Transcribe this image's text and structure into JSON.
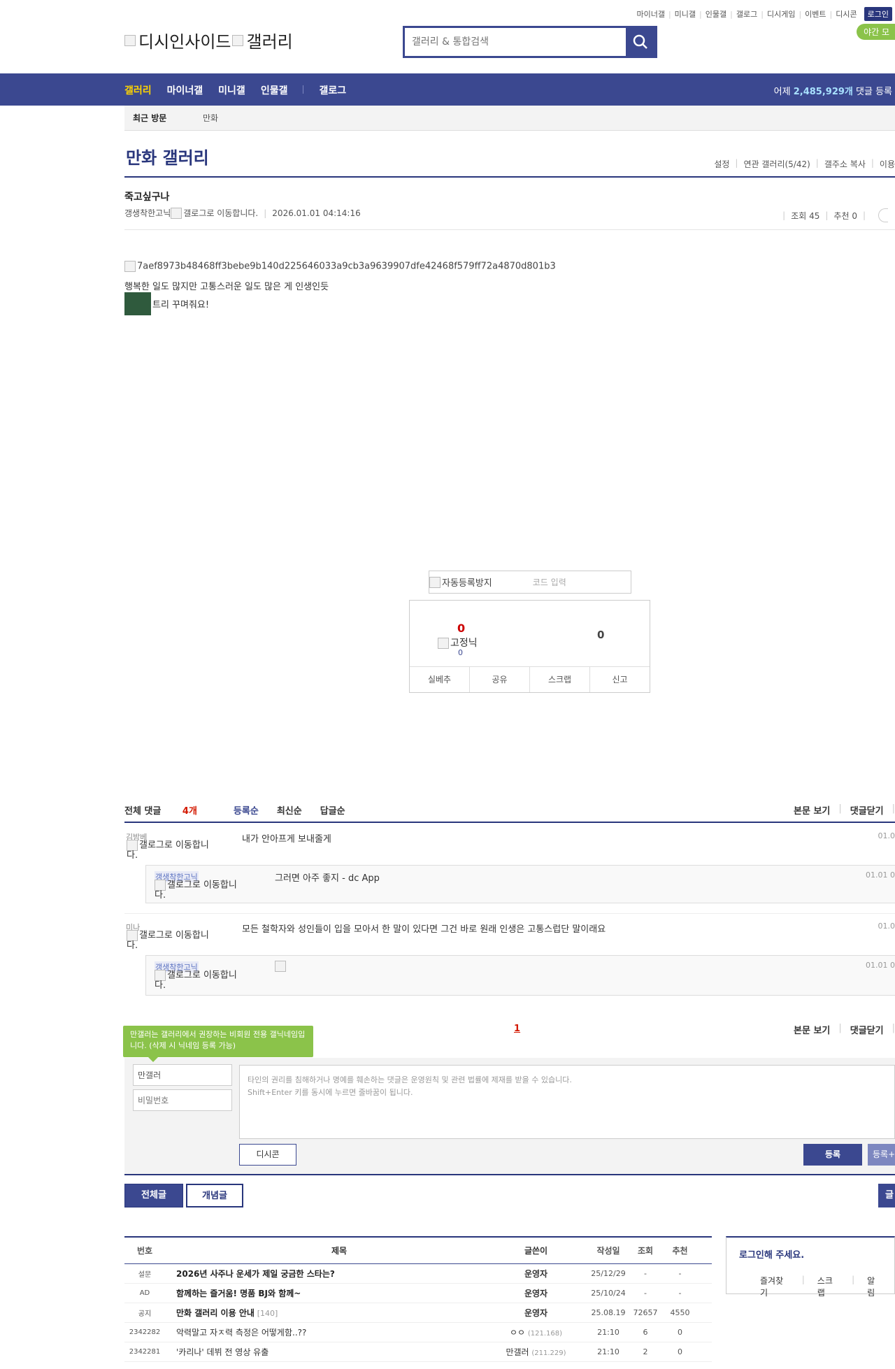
{
  "util_nav": [
    "마이너갤",
    "미니갤",
    "인물갤",
    "갤로그",
    "디시게임",
    "이벤트",
    "디시콘"
  ],
  "login_label": "로그인",
  "night_mode": "야간 모",
  "logo": {
    "site": "디시인사이드",
    "section": "갤러리"
  },
  "search": {
    "placeholder": "갤러리 & 통합검색"
  },
  "gnb": {
    "items": [
      "갤러리",
      "마이너갤",
      "미니갤",
      "인물갤"
    ],
    "gallog": "갤로그",
    "stat_prefix": "어제",
    "stat_value": "2,485,929개",
    "stat_suffix": "댓글 등록"
  },
  "recent": {
    "label": "최근 방문",
    "item": "만화"
  },
  "gallery": {
    "title": "만화 갤러리",
    "links": [
      "설정",
      "연관 갤러리(5/42)",
      "갤주소 복사",
      "이용"
    ]
  },
  "post": {
    "title": "죽고싶구나",
    "writer": "갱생착한고닉",
    "gallog_alt": "갤로그로 이동합니다.",
    "date": "2026.01.01 04:14:16",
    "views": "조회 45",
    "recommend": "추천 0",
    "image_alt": "7aef8973b48468ff3bebe9b140d225646033a9cb3a9639907dfe42468f579ff72a4870d801b3",
    "line1": "행복한 일도 많지만 고통스러운 일도 많은 게 인생인듯",
    "line2": "트리 꾸며줘요!"
  },
  "captcha": {
    "alt": "자동등록방지",
    "placeholder": "코드 입력"
  },
  "vote": {
    "up_count": "0",
    "fix_label": "고정닉",
    "fix_count": "0",
    "down_count": "0",
    "buttons": [
      "실베추",
      "공유",
      "스크랩",
      "신고"
    ]
  },
  "comments_header": {
    "total_label": "전체 댓글",
    "total_count": "4개",
    "sorts": [
      "등록순",
      "최신순",
      "답글순"
    ],
    "right": [
      "본문 보기",
      "댓글닫기"
    ]
  },
  "comments": [
    {
      "nick": "김밤베",
      "gallog": "갤로그로 이동합니다.",
      "text": "내가 안아프게 보내줄게",
      "date": "01.0",
      "reply": {
        "nick": "갱생착한고닉",
        "gallog": "갤로그로 이동합니다.",
        "text": "그러면 아주 좋지 - dc App",
        "date": "01.01 0"
      }
    },
    {
      "nick": "미나",
      "gallog": "갤로그로 이동합니다.",
      "text": "모든 철학자와 성인들이 입을 모아서 한 말이 있다면 그건 바로 원래 인생은 고통스럽단 말이래요",
      "date": "01.0",
      "reply": {
        "nick": "갱생착한고닉",
        "gallog": "갤로그로 이동합니다.",
        "text": "",
        "date": "01.01 0"
      }
    }
  ],
  "pagination": {
    "current": "1"
  },
  "write": {
    "tooltip": "만갤러는 갤러리에서 권장하는 비회원 전용 갤닉네임입니다. (삭제 시 닉네임 등록 가능)",
    "nick_value": "만갤러",
    "pw_placeholder": "비밀번호",
    "notice": "타인의 권리를 침해하거나 명예를 훼손하는 댓글은 운영원칙 및 관련 법률에 제재를 받을 수 있습니다.",
    "notice2": "Shift+Enter 키를 동시에 누르면 줄바꿈이 됩니다.",
    "dccon": "디시콘",
    "submit": "등록",
    "submit2": "등록+"
  },
  "tabs": {
    "all": "전체글",
    "recommend": "개념글",
    "write": "글"
  },
  "list": {
    "headers": [
      "번호",
      "제목",
      "글쓴이",
      "작성일",
      "조회",
      "추천"
    ],
    "rows": [
      {
        "no": "설문",
        "title": "2026년 사주나 운세가 제일 궁금한 스타는?",
        "bold": true,
        "writer": "운영자",
        "ip": "",
        "date": "25/12/29",
        "views": "-",
        "rec": "-"
      },
      {
        "no": "AD",
        "title": "함께하는 즐거움! 명품 BJ와 함께~",
        "bold": true,
        "writer": "운영자",
        "ip": "",
        "date": "25/10/24",
        "views": "-",
        "rec": "-"
      },
      {
        "no": "공지",
        "title": "만화 갤러리 이용 안내",
        "rc": "[140]",
        "bold": true,
        "writer": "운영자",
        "ip": "",
        "date": "25.08.19",
        "views": "72657",
        "rec": "4550"
      },
      {
        "no": "2342282",
        "title": "악력말고 자ㅈ력 측정은 어떻게함..??",
        "bold": false,
        "writer": "ㅇㅇ",
        "ip": "(121.168)",
        "date": "21:10",
        "views": "6",
        "rec": "0"
      },
      {
        "no": "2342281",
        "title": "'카리나' 데뷔 전 영상 유출",
        "bold": false,
        "writer": "만갤러",
        "ip": "(211.229)",
        "date": "21:10",
        "views": "2",
        "rec": "0"
      }
    ]
  },
  "login_box": {
    "title": "로그인해 주세요.",
    "links": [
      "즐겨찾기",
      "스크랩",
      "알림"
    ]
  }
}
